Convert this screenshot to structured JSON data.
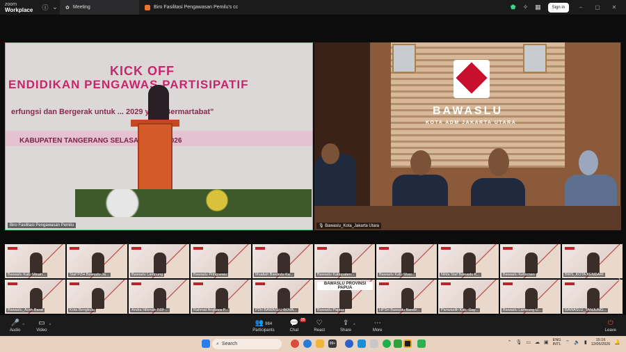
{
  "app": {
    "brand_line1": "zoom",
    "brand_line2": "Workplace"
  },
  "tabs": [
    {
      "label": "Meeting"
    },
    {
      "label": "Biro Fasilitasi Pengawasan Pemilu's cc"
    }
  ],
  "titlebar": {
    "signin_label": "Sign in"
  },
  "videos": {
    "main_left": {
      "label": "Biro Fasilitasi Pengawasan Pemilu",
      "banner_line1": "KICK OFF",
      "banner_line2": "ENDIDIKAN PENGAWAS PARTISIPATIF",
      "banner_line3": "erfungsi dan Bergerak untuk ... 2029 yang Bermartabat\"",
      "banner_line4": "KABUPATEN TANGERANG      SELASA, 12 MEI 2026"
    },
    "main_right": {
      "label": "Bawaslu_Kota_Jakarta Utara",
      "sign_title": "BAWASLU",
      "sign_subtitle": "KOTA ADM JAKARTA UTARA"
    }
  },
  "gallery": {
    "row1": [
      "Bawaslu Kab. Minah...",
      "Staf PZH Bawaslu Ja...",
      "Bawaslu Lampung",
      "Bawaslu Pringsewu",
      "Mualiah Bawaslu Ka...",
      "Bawaslu Kabupaten...",
      "Bawaslu Kab. Musi...",
      "Nihla Staf Bawaslu K...",
      "Bawaslu Kebumen",
      "BWS_KOTA KENDARI"
    ],
    "row2": [
      "Bawaslu_Aceh Barat",
      "Kota Bengkulu",
      "Andra Hikmah PZP ...",
      "Rahmat Angkara P...",
      "P2H BAWASLU BOVA...",
      "Bawaslu Papua",
      "HP3H Bawaslu Bande...",
      "Panwaslih Kab. Gay...",
      "Bawaslu Lampung U...",
      "BAWASLU_TANJUNG..."
    ],
    "papua_title": "BAWASLU PROVINSI PAPUA"
  },
  "toolbar": {
    "audio": "Audio",
    "video": "Video",
    "participants": "Participants",
    "participants_count": "984",
    "chat": "Chat",
    "chat_badge": "28",
    "react": "React",
    "share": "Share",
    "more": "More",
    "leave": "Leave"
  },
  "taskbar": {
    "search_placeholder": "Search",
    "lang_line1": "ENG",
    "lang_line2": "INTL",
    "time": "15:16",
    "date": "12/05/2026",
    "badge_count": "99+"
  }
}
